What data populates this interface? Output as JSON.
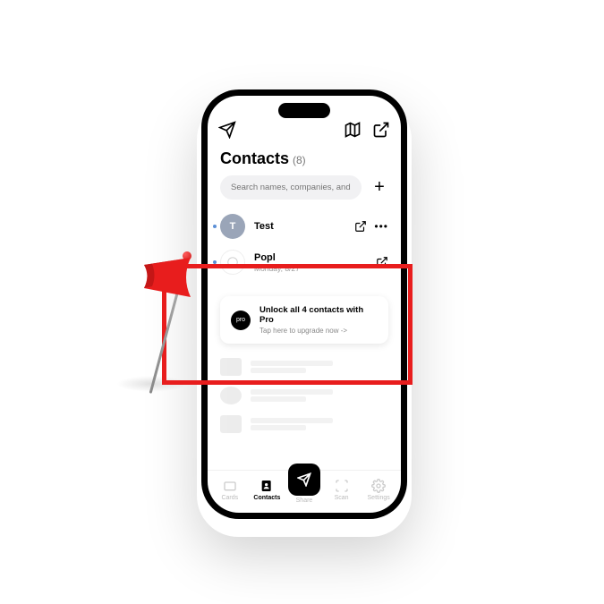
{
  "header": {
    "title": "Contacts",
    "count": "(8)"
  },
  "search": {
    "placeholder": "Search names, companies, and t"
  },
  "contacts": [
    {
      "avatar_letter": "T",
      "name": "Test",
      "sub": ""
    },
    {
      "avatar_letter": "",
      "name": "Popl",
      "sub": "Monday, 8/27"
    }
  ],
  "upgrade": {
    "badge": "pro",
    "title": "Unlock all 4 contacts with Pro",
    "subtitle": "Tap here to upgrade now ->"
  },
  "nav": {
    "items": [
      {
        "label": "Cards"
      },
      {
        "label": "Contacts"
      },
      {
        "label": "Share"
      },
      {
        "label": "Scan"
      },
      {
        "label": "Settings"
      }
    ]
  }
}
